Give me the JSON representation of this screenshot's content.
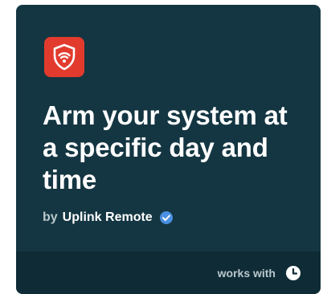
{
  "card": {
    "app_icon": "uplink-shield-wifi-icon",
    "title": "Arm your system at a specific day and time",
    "by_label": "by",
    "author": "Uplink Remote",
    "verified_icon": "verified-check-icon",
    "footer": {
      "works_with_label": "works with",
      "service_icon": "clock-icon"
    }
  },
  "colors": {
    "card_background": "#143642",
    "footer_background": "#0f2b35",
    "app_icon_background": "#e23b2e",
    "verified_blue": "#4a90e2",
    "text_primary": "#ffffff",
    "text_secondary": "#b9c8cd"
  }
}
